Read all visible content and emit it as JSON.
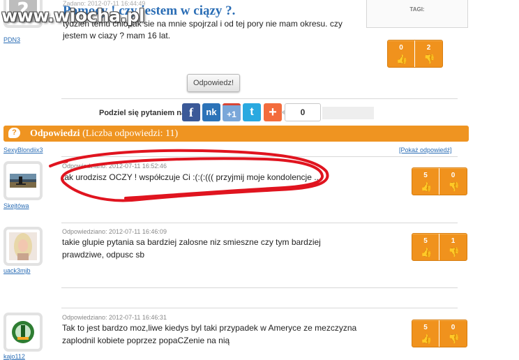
{
  "watermark": "www.wiocha.pl",
  "question": {
    "meta": "Zadano: 2012-07-11 16:44:49",
    "title": "Pomocy ! czy jestem w ciązy ?.",
    "body": "tydzien temu chlopak sie na mnie spojrzal i od tej pory nie mam okresu. czy jestem w ciazy ? mam 16 lat.",
    "user": "PDN3",
    "votes_up": "0",
    "votes_down": "2"
  },
  "tags_label": "TAGI:",
  "answer_button": "Odpowiedz!",
  "share": {
    "label": "Podziel się pytaniem na:",
    "fb": "f",
    "nk": "nk",
    "gplus": "+1",
    "tw": "t",
    "more": "+",
    "count": "0"
  },
  "answers_header": {
    "title": "Odpowiedzi",
    "count_text": "(Liczba odpowiedzi: 11)"
  },
  "top_user": "SexyBlondiix3",
  "show_answers": "[Pokaż odpowiedź]",
  "answers": [
    {
      "user": "Skejtówa",
      "meta": "Odpowiedziano: 2012-07-11 16:52:46",
      "text": "tak urodzisz OCZY ! współczuje Ci :(:(:((( przyjmij moje kondolencje ...",
      "up": "5",
      "down": "0"
    },
    {
      "user": "uack3mjb",
      "meta": "Odpowiedziano: 2012-07-11 16:46:09",
      "text": "takie glupie pytania sa bardziej zalosne niz smieszne czy tym bardziej prawdziwe, odpusc sb",
      "up": "5",
      "down": "1"
    },
    {
      "user": "kajo112",
      "meta": "Odpowiedziano: 2012-07-11 16:46:31",
      "text": "Tak to jest bardzo moz,liwe kiedys byl taki przypadek w Ameryce ze mezczyzna zaplodnil kobiete poprzez popaCZenie na nią",
      "up": "5",
      "down": "0"
    }
  ],
  "colors": {
    "accent": "#ef9421",
    "link": "#2a6db5",
    "scribble": "#e0141f"
  }
}
